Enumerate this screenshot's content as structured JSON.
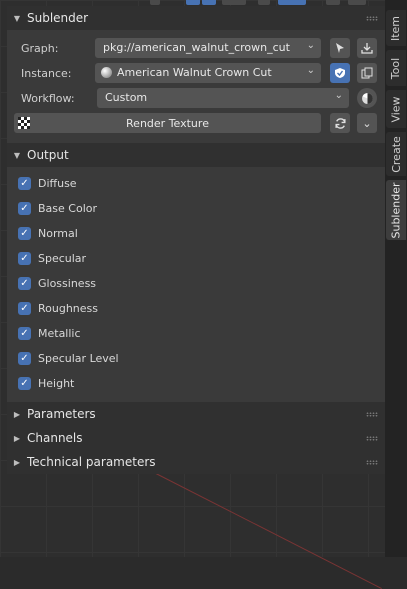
{
  "sidebar_tabs": [
    "Item",
    "Tool",
    "View",
    "Create",
    "Sublender"
  ],
  "panel": {
    "title": "Sublender",
    "graph_label": "Graph:",
    "graph_value": "pkg://american_walnut_crown_cut",
    "instance_label": "Instance:",
    "instance_value": "American Walnut Crown Cut",
    "workflow_label": "Workflow:",
    "workflow_value": "Custom",
    "render_label": "Render Texture"
  },
  "output": {
    "title": "Output",
    "items": [
      "Diffuse",
      "Base Color",
      "Normal",
      "Specular",
      "Glossiness",
      "Roughness",
      "Metallic",
      "Specular Level",
      "Height"
    ]
  },
  "collapsed_sections": [
    "Parameters",
    "Channels",
    "Technical parameters"
  ],
  "colors": {
    "accent": "#4772b3",
    "panel": "#3a3a3a",
    "header": "#303030",
    "field": "#545454"
  },
  "icons": [
    "chevron-down-icon",
    "pointer-icon",
    "download-icon",
    "shield-icon",
    "copy-icon",
    "contrast-icon",
    "checker-icon",
    "refresh-icon",
    "sphere-icon"
  ]
}
